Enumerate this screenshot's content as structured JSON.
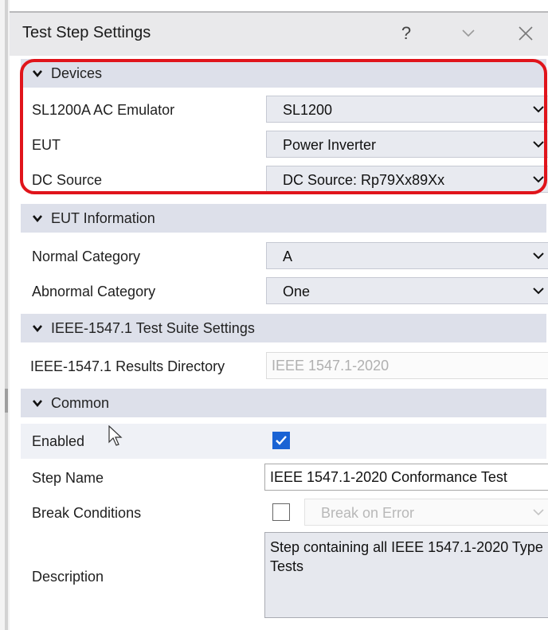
{
  "window": {
    "title": "Test Step Settings",
    "help_label": "?",
    "icons": [
      "help-icon",
      "chevron-down-icon",
      "close-icon"
    ]
  },
  "sections": {
    "devices": {
      "title": "Devices",
      "rows": {
        "ac_emulator": {
          "label": "SL1200A AC Emulator",
          "value": "SL1200"
        },
        "eut": {
          "label": "EUT",
          "value": "Power Inverter"
        },
        "dc_source": {
          "label": "DC Source",
          "value": "DC Source: Rp79Xx89Xx"
        }
      }
    },
    "eut_info": {
      "title": "EUT Information",
      "rows": {
        "normal_category": {
          "label": "Normal Category",
          "value": "A"
        },
        "abnormal_category": {
          "label": "Abnormal Category",
          "value": "One"
        }
      }
    },
    "ieee": {
      "title": "IEEE-1547.1 Test Suite Settings",
      "rows": {
        "results_dir": {
          "label": "IEEE-1547.1 Results Directory",
          "value": "IEEE 1547.1-2020"
        }
      }
    },
    "common": {
      "title": "Common",
      "rows": {
        "enabled": {
          "label": "Enabled",
          "checked": true
        },
        "step_name": {
          "label": "Step Name",
          "value": "IEEE 1547.1-2020 Conformance Test"
        },
        "break_conditions": {
          "label": "Break Conditions",
          "checked": false,
          "value": "Break on Error"
        },
        "description": {
          "label": "Description",
          "value": "Step containing all IEEE 1547.1-2020 Type Tests"
        }
      }
    }
  },
  "colors": {
    "section_header": "#dde0ea",
    "highlight": "#e0141b",
    "checkbox_checked": "#1a63d4"
  }
}
